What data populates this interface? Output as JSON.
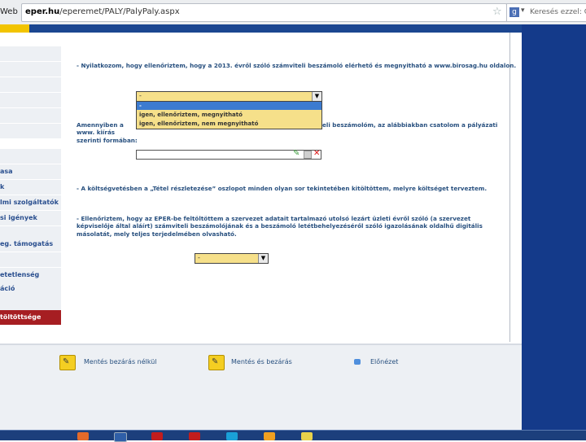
{
  "browser": {
    "tab_label": "Web",
    "url_host": "eper.hu",
    "url_path": "/eperemet/PALY/PalyPaly.aspx",
    "search_placeholder": "Keresés ezzel: Go"
  },
  "sidebar": {
    "items": [
      "",
      "",
      "",
      "",
      "",
      "",
      "",
      "asa",
      "k",
      "lmi szolgáltatók",
      "si igények",
      "",
      "eg. támogatás",
      "",
      "etetlenség",
      "áció",
      "",
      ""
    ],
    "active_label": "töltöttsége"
  },
  "content": {
    "statement1": "- Nyilatkozom, hogy ellenőriztem, hogy a 2013. évről szóló számviteli beszámoló elérhető és megnyitható a www.birosag.hu oldalon.",
    "select1": {
      "value": "-",
      "options": [
        "-",
        "igen, ellenőriztem, megnyitható",
        "igen, ellenőriztem, nem megnyitható"
      ]
    },
    "statement2_left": "Amennyiben a www. kiírás szerinti formában:",
    "statement2_right": "eli beszámolóm, az alábbiakban csatolom a pályázati",
    "statement3": "- A költségvetésben a „Tétel részletezése” oszlopot minden olyan sor tekintetében kitöltöttem, melyre költséget terveztem.",
    "statement4": "- Ellenőriztem, hogy az EPER-be feltöltöttem a szervezet adatait tartalmazó utolsó lezárt üzleti évről szóló (a szervezet képviselője által aláírt) számviteli beszámolójának és a beszámoló letétbehelyezéséről szóló igazolásának oldalhű digitális másolatát, mely teljes terjedelmében olvasható.",
    "select2": {
      "value": "-"
    }
  },
  "actions": {
    "save_no_close": "Mentés bezárás nélkül",
    "save_close": "Mentés és bezárás",
    "preview": "Előnézet"
  },
  "colors": {
    "header_blue": "#1b4690",
    "accent_yellow": "#f2c400",
    "active_red": "#a61e22",
    "select_yellow": "#f6e08a",
    "text_blue": "#28507f"
  }
}
